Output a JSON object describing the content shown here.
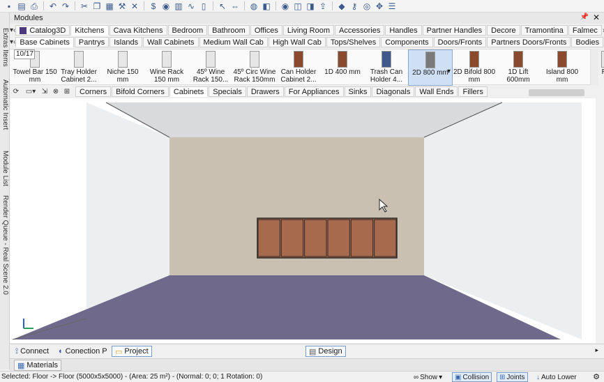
{
  "toolbar": {
    "icons": [
      "save-icon",
      "open-icon",
      "print-icon",
      "undo-icon",
      "redo-icon",
      "cut-icon",
      "copy-icon",
      "paste-icon",
      "hammer-icon",
      "delete-icon",
      "currency-icon",
      "palette-icon",
      "layout-icon",
      "curve-icon",
      "door-icon",
      "pointer-icon",
      "measure-icon",
      "globe-icon",
      "render-3d-icon",
      "eye-icon",
      "camera-icon",
      "view-icon",
      "export-icon",
      "cube-icon",
      "key-icon",
      "snap-icon",
      "move-icon",
      "layers-icon"
    ]
  },
  "side_panel": {
    "labels": [
      "Extras Items",
      "Automatic Insert",
      "Module List",
      "Render Queue - Real Scene 2.0"
    ]
  },
  "modules": {
    "title": "Modules",
    "pin": "📌",
    "close": "✕",
    "catalog": "Catalog3D",
    "category_tabs": [
      "Kitchens",
      "Cava Kitchens",
      "Bedroom",
      "Bathroom",
      "Offices",
      "Living Room",
      "Accessories",
      "Handles",
      "Partner Handles",
      "Decore",
      "Tramontina",
      "Falmec"
    ],
    "active_category": "Kitchens",
    "group_tabs": [
      "Base Cabinets",
      "Pantrys",
      "Islands",
      "Wall Cabinets",
      "Medium Wall Cab",
      "High Wall Cab",
      "Tops/Shelves",
      "Components",
      "Doors/Fronts",
      "Partners Doors/Fronts",
      "Bodies"
    ],
    "active_group": "Base Cabinets",
    "counter": "10/17",
    "items": [
      {
        "label": "Towel Bar 150 mm",
        "type": "white"
      },
      {
        "label": "Tray Holder Cabinet 2...",
        "type": "white"
      },
      {
        "label": "Niche 150 mm",
        "type": "white"
      },
      {
        "label": "Wine Rack 150 mm",
        "type": "white"
      },
      {
        "label": "45º Wine Rack 150...",
        "type": "white"
      },
      {
        "label": "45º Circ Wine Rack 150mm",
        "type": "white"
      },
      {
        "label": "Can Holder Cabinet 2...",
        "type": "brown"
      },
      {
        "label": "1D 400 mm",
        "type": "brown"
      },
      {
        "label": "Trash Can Holder 4...",
        "type": "blue"
      },
      {
        "label": "2D 800 mm",
        "type": "grey",
        "selected": true
      },
      {
        "label": "2D Bifold 800 mm",
        "type": "brown"
      },
      {
        "label": "1D Lift 600mm",
        "type": "brown"
      },
      {
        "label": "Island 800 mm",
        "type": "brown"
      },
      {
        "label": "Re",
        "type": "white"
      }
    ],
    "sub_tabs": [
      "Corners",
      "Bifold Corners",
      "Cabinets",
      "Specials",
      "Drawers",
      "For Appliances",
      "Sinks",
      "Diagonals",
      "Wall Ends",
      "Fillers"
    ],
    "active_sub": "Cabinets"
  },
  "scene": {
    "ceiling_color": "#d9dadb",
    "side_wall_color": "#eceeef",
    "back_wall_color": "#c9c0b2",
    "floor_color": "#6f6a8c",
    "cabinet_color": "#a86a4c",
    "cabinet_edge_color": "#2e2a28",
    "cabinet_door_count": 6
  },
  "bottom_tabs": {
    "connect": "Connect",
    "conection": "Conection P",
    "project": "Project",
    "design": "Design"
  },
  "materials_tab": "Materials",
  "status": {
    "text": "Selected: Floor -> Floor (5000x5x5000) - (Area: 25 m²) - (Normal: 0; 0; 1 Rotation: 0)",
    "show": "Show",
    "collision": "Collision",
    "joints": "Joints",
    "auto_lower": "Auto Lower"
  }
}
